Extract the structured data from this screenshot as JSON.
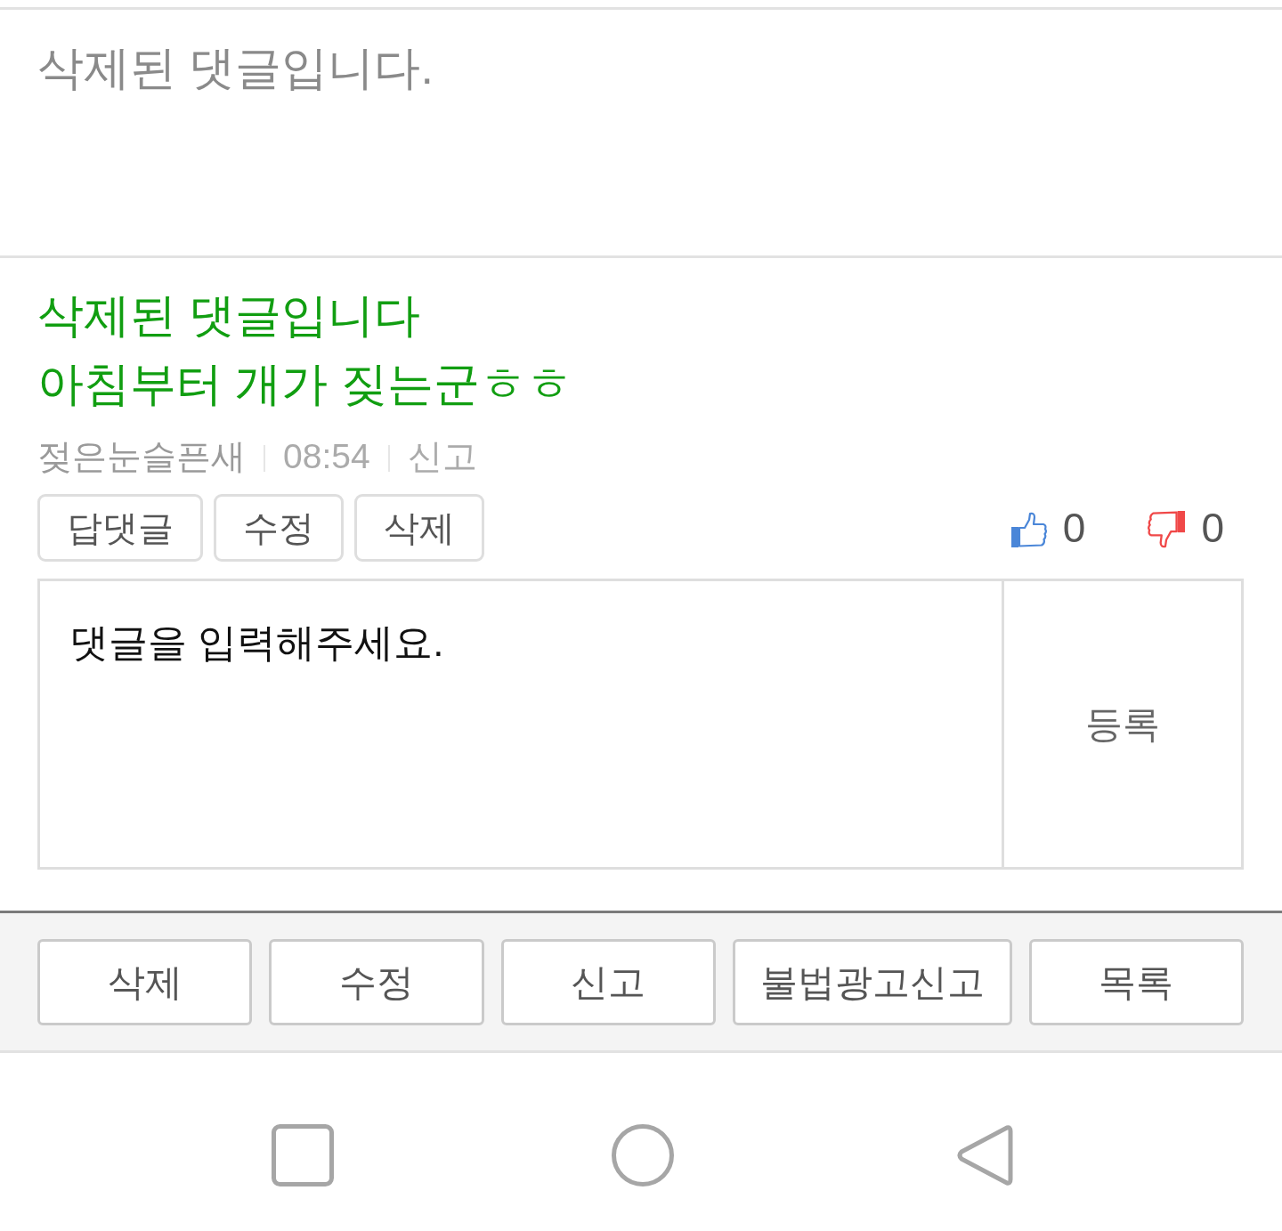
{
  "deleted_post": {
    "text": "삭제된 댓글입니다."
  },
  "comment": {
    "body": "삭제된 댓글입니다\n아침부터 개가 짖는군ㅎㅎ",
    "author": "젖은눈슬픈새",
    "time": "08:54",
    "report": "신고",
    "actions": [
      "답댓글",
      "수정",
      "삭제"
    ],
    "likes": "0",
    "dislikes": "0"
  },
  "reply_form": {
    "placeholder": "댓글을 입력해주세요.",
    "submit": "등록"
  },
  "bottom_actions": [
    "삭제",
    "수정",
    "신고",
    "불법광고신고",
    "목록"
  ]
}
